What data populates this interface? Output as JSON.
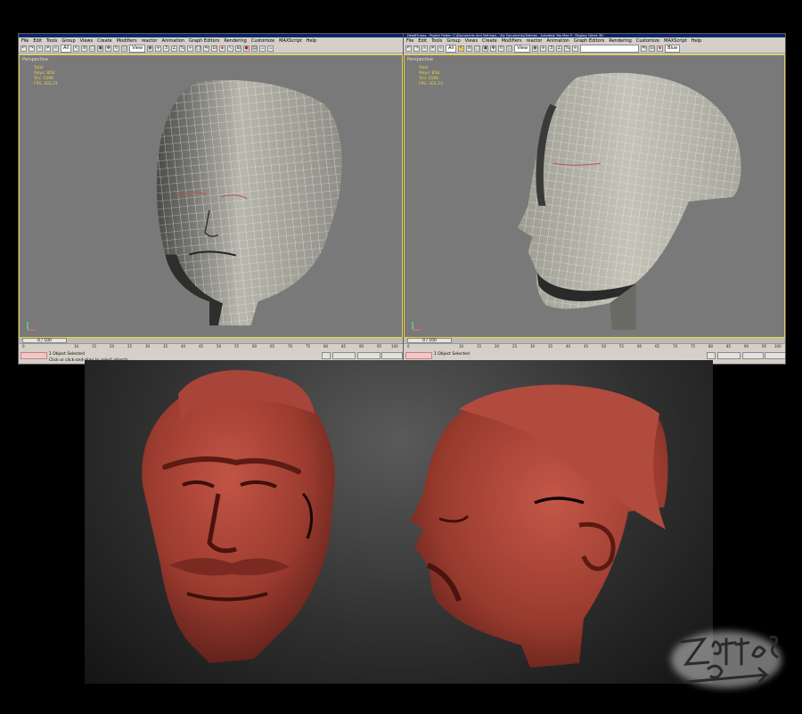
{
  "menu": [
    "File",
    "Edit",
    "Tools",
    "Group",
    "Views",
    "Create",
    "Modifiers",
    "reactor",
    "Animation",
    "Graph Editors",
    "Rendering",
    "Customize",
    "MAXScript",
    "Help"
  ],
  "right_title": "HeadHi.max - Project Folder: C:\\Documents and Settings\\...\\My Documents\\3dsmax - Autodesk 3ds Max 9 - Display: Direct 3D",
  "toolbar": {
    "selection_filter": "All",
    "coord_system": "View",
    "named_selection": "Blue"
  },
  "viewports": [
    {
      "id": "left",
      "label": "Perspective",
      "stats": [
        "Total",
        "Polys: 858",
        "Tris: 1596",
        "FPS: 302.21"
      ]
    },
    {
      "id": "right",
      "label": "Perspective",
      "stats": [
        "Total",
        "Polys: 858",
        "Tris: 1596",
        "FPS: 301.23"
      ]
    }
  ],
  "timeline": {
    "slider": "0 / 100",
    "ticks": [
      "0",
      "10",
      "15",
      "20",
      "25",
      "30",
      "35",
      "40",
      "45",
      "50",
      "55",
      "60",
      "65",
      "70",
      "75",
      "80",
      "85",
      "90",
      "95",
      "100"
    ]
  },
  "status": {
    "selection": "1 Object Selected",
    "prompt": "Click or click-and-drag to select objects"
  },
  "colors": {
    "viewport_bg": "#797979",
    "active_border": "#e4d34a",
    "clay": "#9b3b2f",
    "ui_gray": "#d4d0c8"
  },
  "icons": [
    "undo-icon",
    "redo-icon",
    "link-icon",
    "unlink-icon",
    "bind-icon",
    "select-icon",
    "select-region-icon",
    "move-icon",
    "rotate-icon",
    "scale-icon",
    "mirror-icon",
    "align-icon",
    "render-icon",
    "logo-signature"
  ]
}
